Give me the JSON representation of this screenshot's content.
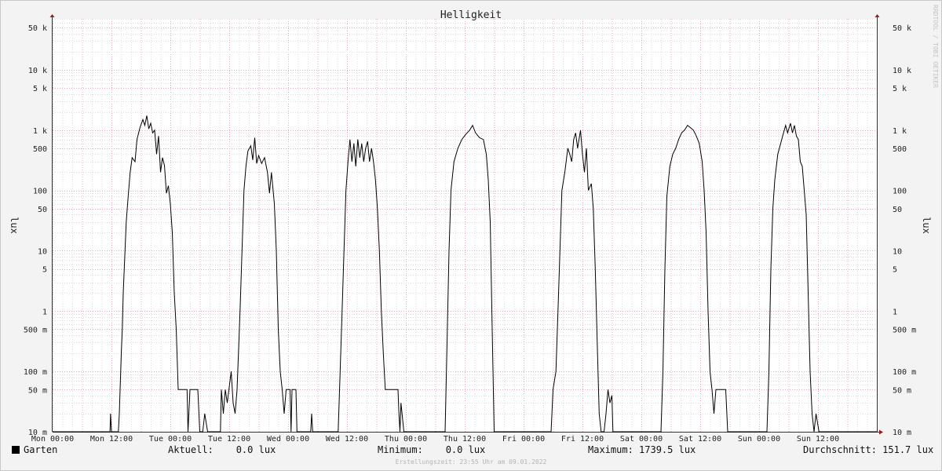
{
  "chart_data": {
    "type": "line",
    "title": "Helligkeit",
    "ylabel": "lux",
    "yscale": "log",
    "ylim": [
      0.01,
      70000
    ],
    "grid": true,
    "legend": "bottom",
    "yticks": [
      {
        "value": 50000,
        "label": "50 k"
      },
      {
        "value": 10000,
        "label": "10 k"
      },
      {
        "value": 5000,
        "label": "5 k"
      },
      {
        "value": 1000,
        "label": "1 k"
      },
      {
        "value": 500,
        "label": "500"
      },
      {
        "value": 100,
        "label": "100"
      },
      {
        "value": 50,
        "label": "50"
      },
      {
        "value": 10,
        "label": "10"
      },
      {
        "value": 5,
        "label": "5"
      },
      {
        "value": 1,
        "label": "1"
      },
      {
        "value": 0.5,
        "label": "500 m"
      },
      {
        "value": 0.1,
        "label": "100 m"
      },
      {
        "value": 0.05,
        "label": "50 m"
      },
      {
        "value": 0.01,
        "label": "10 m"
      }
    ],
    "xticks": [
      "Mon 00:00",
      "Mon 12:00",
      "Tue 00:00",
      "Tue 12:00",
      "Wed 00:00",
      "Wed 12:00",
      "Thu 00:00",
      "Thu 12:00",
      "Fri 00:00",
      "Fri 12:00",
      "Sat 00:00",
      "Sat 12:00",
      "Sun 00:00",
      "Sun 12:00"
    ],
    "xlim_hours": [
      0,
      168
    ],
    "series": [
      {
        "name": "Garten",
        "color": "#000000",
        "points": [
          [
            0,
            0.01
          ],
          [
            11.7,
            0.01
          ],
          [
            11.8,
            0.02
          ],
          [
            12,
            0.01
          ],
          [
            13.4,
            0.01
          ],
          [
            13.6,
            0.02
          ],
          [
            14,
            0.2
          ],
          [
            14.2,
            0.5
          ],
          [
            14.4,
            2
          ],
          [
            15,
            30
          ],
          [
            15.4,
            80
          ],
          [
            15.8,
            200
          ],
          [
            16.2,
            350
          ],
          [
            16.8,
            300
          ],
          [
            17.2,
            700
          ],
          [
            17.8,
            1100
          ],
          [
            18.4,
            1500
          ],
          [
            18.8,
            1200
          ],
          [
            19.2,
            1739.5
          ],
          [
            19.6,
            1050
          ],
          [
            20,
            1300
          ],
          [
            20.4,
            900
          ],
          [
            20.8,
            1000
          ],
          [
            21.2,
            400
          ],
          [
            21.6,
            800
          ],
          [
            22,
            200
          ],
          [
            22.4,
            350
          ],
          [
            22.8,
            260
          ],
          [
            23.2,
            90
          ],
          [
            23.6,
            120
          ],
          [
            24,
            60
          ],
          [
            24.4,
            20
          ],
          [
            24.8,
            2
          ],
          [
            25.2,
            0.5
          ],
          [
            25.6,
            0.05
          ],
          [
            27.4,
            0.05
          ],
          [
            27.6,
            0.01
          ],
          [
            28,
            0.05
          ],
          [
            29.6,
            0.05
          ],
          [
            30,
            0.01
          ],
          [
            30.6,
            0.01
          ],
          [
            31,
            0.02
          ],
          [
            31.6,
            0.01
          ],
          [
            34.2,
            0.01
          ],
          [
            34.4,
            0.05
          ],
          [
            34.8,
            0.02
          ],
          [
            35.2,
            0.05
          ],
          [
            35.6,
            0.03
          ],
          [
            36.4,
            0.1
          ],
          [
            36.8,
            0.03
          ],
          [
            37.2,
            0.02
          ],
          [
            37.6,
            0.05
          ],
          [
            38.2,
            1
          ],
          [
            38.6,
            10
          ],
          [
            39,
            100
          ],
          [
            39.4,
            250
          ],
          [
            39.8,
            450
          ],
          [
            40.4,
            550
          ],
          [
            40.8,
            320
          ],
          [
            41.2,
            750
          ],
          [
            41.6,
            280
          ],
          [
            42,
            380
          ],
          [
            42.6,
            280
          ],
          [
            43.2,
            350
          ],
          [
            43.8,
            200
          ],
          [
            44.2,
            90
          ],
          [
            44.6,
            200
          ],
          [
            45.2,
            60
          ],
          [
            45.6,
            10
          ],
          [
            46,
            0.5
          ],
          [
            46.4,
            0.1
          ],
          [
            46.8,
            0.05
          ],
          [
            47.2,
            0.02
          ],
          [
            47.6,
            0.05
          ],
          [
            48.4,
            0.05
          ],
          [
            48.6,
            0.01
          ],
          [
            48.8,
            0.05
          ],
          [
            49.6,
            0.05
          ],
          [
            49.8,
            0.01
          ],
          [
            52.6,
            0.01
          ],
          [
            52.8,
            0.02
          ],
          [
            53,
            0.01
          ],
          [
            58.2,
            0.01
          ],
          [
            58.6,
            0.1
          ],
          [
            59,
            1
          ],
          [
            59.4,
            10
          ],
          [
            59.8,
            100
          ],
          [
            60.2,
            300
          ],
          [
            60.6,
            700
          ],
          [
            61,
            300
          ],
          [
            61.4,
            600
          ],
          [
            61.8,
            250
          ],
          [
            62.2,
            700
          ],
          [
            62.6,
            350
          ],
          [
            63,
            600
          ],
          [
            63.4,
            300
          ],
          [
            63.8,
            500
          ],
          [
            64.2,
            650
          ],
          [
            64.6,
            300
          ],
          [
            65,
            500
          ],
          [
            65.4,
            300
          ],
          [
            65.8,
            150
          ],
          [
            66.2,
            50
          ],
          [
            66.6,
            10
          ],
          [
            67,
            1
          ],
          [
            67.4,
            0.2
          ],
          [
            67.8,
            0.05
          ],
          [
            70.4,
            0.05
          ],
          [
            70.6,
            0.02
          ],
          [
            70.8,
            0.01
          ],
          [
            71,
            0.03
          ],
          [
            71.6,
            0.01
          ],
          [
            80,
            0.01
          ],
          [
            80.4,
            0.3
          ],
          [
            80.8,
            10
          ],
          [
            81.2,
            100
          ],
          [
            81.8,
            300
          ],
          [
            82.6,
            500
          ],
          [
            83.4,
            700
          ],
          [
            84.2,
            850
          ],
          [
            85,
            1000
          ],
          [
            85.6,
            1200
          ],
          [
            86.2,
            900
          ],
          [
            87,
            750
          ],
          [
            87.8,
            700
          ],
          [
            88.4,
            400
          ],
          [
            88.8,
            150
          ],
          [
            89.2,
            30
          ],
          [
            89.6,
            0.5
          ],
          [
            90,
            0.01
          ],
          [
            101.6,
            0.01
          ],
          [
            102,
            0.05
          ],
          [
            102.6,
            0.1
          ],
          [
            103,
            1
          ],
          [
            103.4,
            10
          ],
          [
            103.8,
            100
          ],
          [
            104.4,
            200
          ],
          [
            105,
            500
          ],
          [
            105.4,
            400
          ],
          [
            105.8,
            300
          ],
          [
            106.2,
            700
          ],
          [
            106.6,
            900
          ],
          [
            107,
            500
          ],
          [
            107.6,
            1000
          ],
          [
            108,
            400
          ],
          [
            108.4,
            200
          ],
          [
            108.8,
            500
          ],
          [
            109.2,
            100
          ],
          [
            109.8,
            130
          ],
          [
            110.2,
            50
          ],
          [
            110.6,
            5
          ],
          [
            111,
            0.3
          ],
          [
            111.4,
            0.02
          ],
          [
            111.8,
            0.01
          ],
          [
            112.4,
            0.01
          ],
          [
            112.8,
            0.02
          ],
          [
            113.2,
            0.05
          ],
          [
            113.6,
            0.03
          ],
          [
            114,
            0.04
          ],
          [
            114.2,
            0.01
          ],
          [
            124,
            0.01
          ],
          [
            124.4,
            0.1
          ],
          [
            124.8,
            5
          ],
          [
            125.2,
            80
          ],
          [
            125.8,
            250
          ],
          [
            126.4,
            400
          ],
          [
            127,
            500
          ],
          [
            127.6,
            700
          ],
          [
            128.2,
            900
          ],
          [
            128.8,
            1000
          ],
          [
            129.4,
            1200
          ],
          [
            130,
            1100
          ],
          [
            130.6,
            1000
          ],
          [
            131.2,
            800
          ],
          [
            131.8,
            600
          ],
          [
            132.4,
            300
          ],
          [
            132.8,
            100
          ],
          [
            133.2,
            20
          ],
          [
            133.6,
            1
          ],
          [
            134,
            0.1
          ],
          [
            134.4,
            0.05
          ],
          [
            134.8,
            0.02
          ],
          [
            135.2,
            0.05
          ],
          [
            137.2,
            0.05
          ],
          [
            137.6,
            0.01
          ],
          [
            145.6,
            0.01
          ],
          [
            146,
            0.1
          ],
          [
            146.4,
            5
          ],
          [
            146.8,
            50
          ],
          [
            147.2,
            150
          ],
          [
            147.8,
            400
          ],
          [
            148.4,
            600
          ],
          [
            148.8,
            800
          ],
          [
            149.4,
            1200
          ],
          [
            149.8,
            900
          ],
          [
            150.4,
            1300
          ],
          [
            150.8,
            900
          ],
          [
            151.2,
            1200
          ],
          [
            151.6,
            800
          ],
          [
            152,
            700
          ],
          [
            152.4,
            300
          ],
          [
            152.8,
            250
          ],
          [
            153.2,
            100
          ],
          [
            153.6,
            40
          ],
          [
            154,
            2
          ],
          [
            154.4,
            0.1
          ],
          [
            154.8,
            0.02
          ],
          [
            155.2,
            0.01
          ],
          [
            155.6,
            0.02
          ],
          [
            156.2,
            0.01
          ],
          [
            168,
            0.01
          ]
        ]
      }
    ]
  },
  "legend": {
    "series_name": "Garten",
    "aktuell": "Aktuell:    0.0 lux",
    "minimum": "Minimum:    0.0 lux",
    "maximum": "Maximum: 1739.5 lux",
    "durchschnitt": "Durchschnitt: 151.7 lux"
  },
  "footer": "Erstellungszeit: 23:55 Uhr am 09.01.2022",
  "watermark": "RRDTOOL / TOBI OETIKER"
}
